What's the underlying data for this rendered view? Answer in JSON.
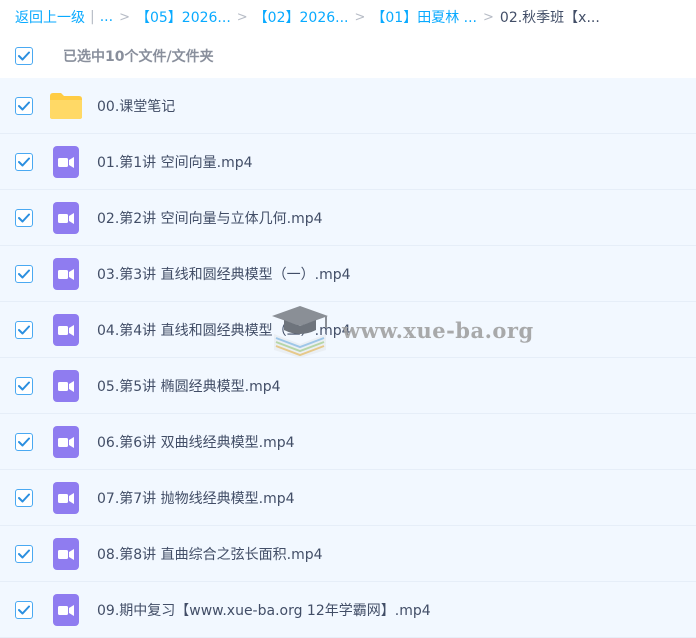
{
  "breadcrumb": {
    "back": "返回上一级",
    "separator": "|",
    "ellipsis": "...",
    "gt": ">",
    "items": [
      "【05】2026...",
      "【02】2026...",
      "【01】田夏林 ...",
      "02.秋季班【x..."
    ]
  },
  "selection": {
    "label": "已选中10个文件/文件夹",
    "checked": true
  },
  "files": [
    {
      "name": "00.课堂笔记",
      "type": "folder"
    },
    {
      "name": "01.第1讲 空间向量.mp4",
      "type": "video"
    },
    {
      "name": "02.第2讲 空间向量与立体几何.mp4",
      "type": "video"
    },
    {
      "name": "03.第3讲 直线和圆经典模型（一）.mp4",
      "type": "video"
    },
    {
      "name": "04.第4讲 直线和圆经典模型（二）.mp4",
      "type": "video"
    },
    {
      "name": "05.第5讲 椭圆经典模型.mp4",
      "type": "video"
    },
    {
      "name": "06.第6讲 双曲线经典模型.mp4",
      "type": "video"
    },
    {
      "name": "07.第7讲 抛物线经典模型.mp4",
      "type": "video"
    },
    {
      "name": "08.第8讲 直曲综合之弦长面积.mp4",
      "type": "video"
    },
    {
      "name": "09.期中复习【www.xue-ba.org 12年学霸网】.mp4",
      "type": "video"
    }
  ],
  "watermark": {
    "text": "www.xue-ba.org"
  },
  "colors": {
    "link": "#09aaff",
    "checkbox": "#4aa9f2",
    "row_bg": "#f2f8ff",
    "video_icon": "#8f7cf0",
    "folder_icon": "#ffcc44"
  },
  "icons": {
    "folder": "folder-icon",
    "video": "video-file-icon",
    "check": "checkbox-checked-icon"
  }
}
